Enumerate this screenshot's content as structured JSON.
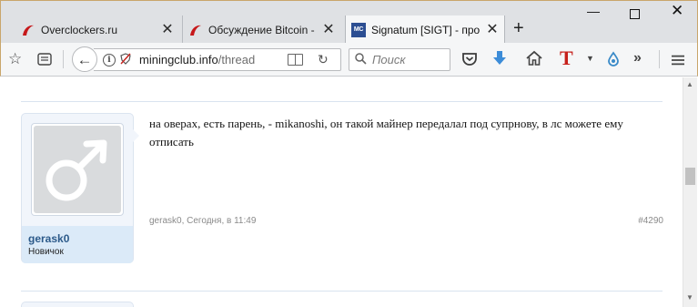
{
  "tabs": [
    {
      "title": "Overclockers.ru",
      "icon": "overclockers-icon"
    },
    {
      "title": "Обсуждение Bitcoin - ",
      "icon": "overclockers-icon"
    },
    {
      "title": "Signatum [SIGT] - про",
      "icon": "miningclub-icon",
      "favicon_text": "MC",
      "active": true
    }
  ],
  "new_tab_label": "+",
  "window_controls": {
    "minimize": "—",
    "close": "✕"
  },
  "toolbar": {
    "url_host": "miningclub.info",
    "url_path": "/thread",
    "search_placeholder": "Поиск"
  },
  "post": {
    "username": "gerask0",
    "user_title": "Новичок",
    "message": "на оверах, есть парень, - mikanoshi, он такой майнер передалал под супрнову, в лс можете ему отписать",
    "author": "gerask0",
    "time": ", Сегодня, в 11:49",
    "permalink": "#4290"
  },
  "colors": {
    "username": "#2c5a8a",
    "user_panel": "#dbeaf8",
    "accent_red": "#c6201b",
    "download_blue": "#3c8cd8"
  }
}
